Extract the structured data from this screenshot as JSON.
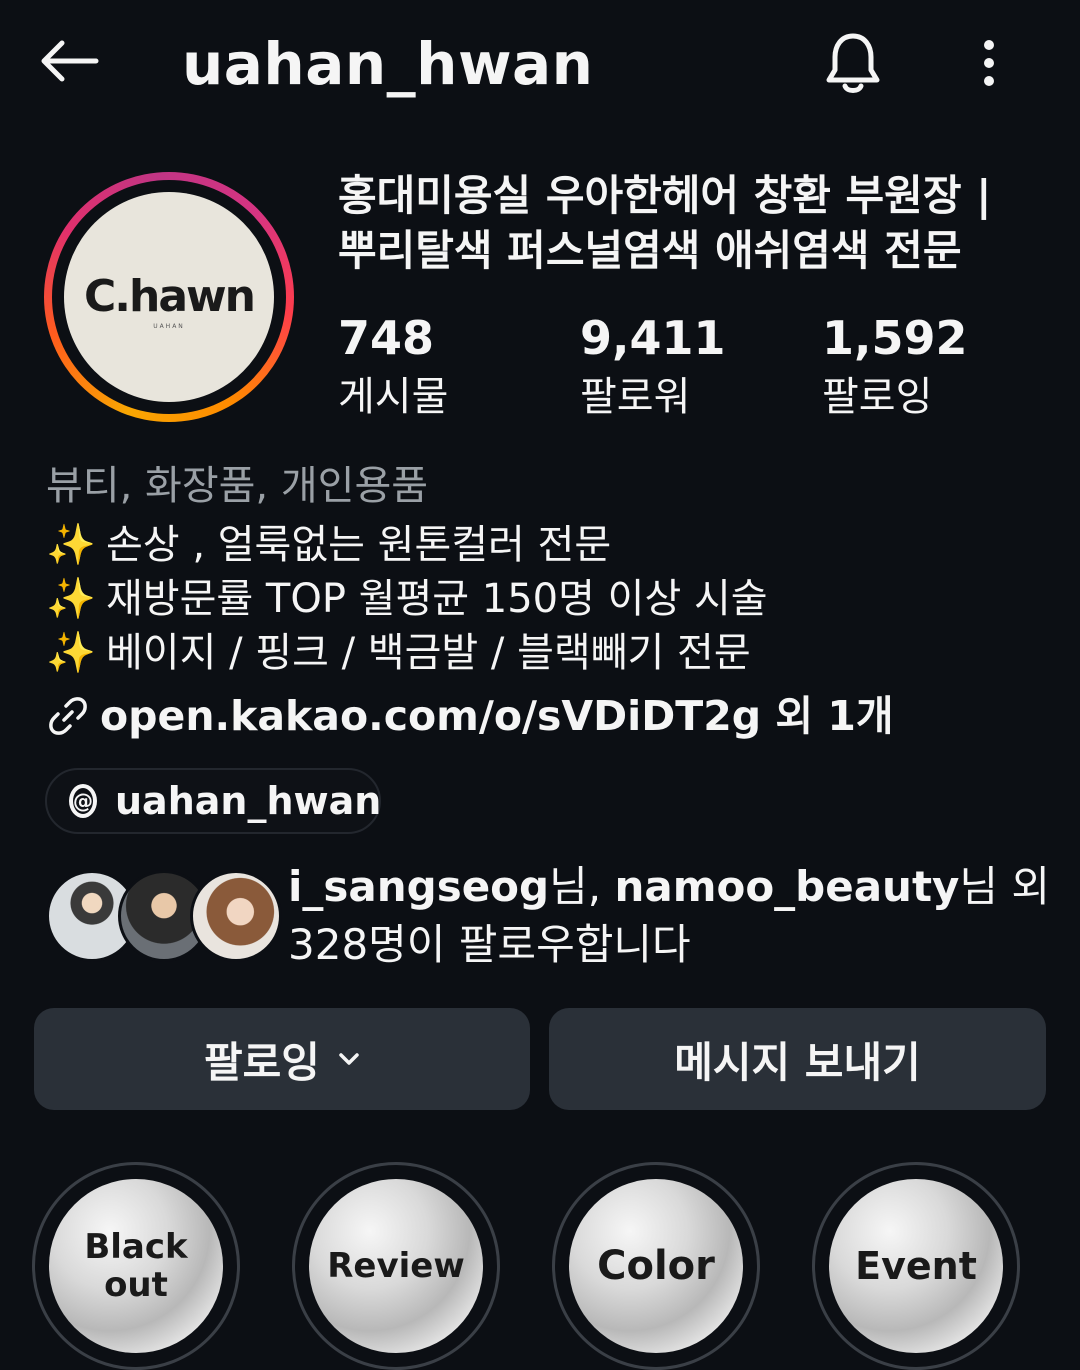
{
  "header": {
    "username": "uahan_hwan",
    "back_icon": "back-arrow-icon",
    "notification_icon": "bell-icon",
    "more_icon": "more-vertical-icon"
  },
  "profile": {
    "avatar_logo_text": "C.hawn",
    "avatar_logo_sub": "UAHAN",
    "name_line1": "홍대미용실 우아한헤어 창환 부원장 |",
    "name_line2": "뿌리탈색 퍼스널염색 애쉬염색 전문"
  },
  "stats": [
    {
      "value": "748",
      "label": "게시물"
    },
    {
      "value": "9,411",
      "label": "팔로워"
    },
    {
      "value": "1,592",
      "label": "팔로잉"
    }
  ],
  "bio": {
    "category": "뷰티, 화장품, 개인용품",
    "lines": [
      {
        "emoji": "✨",
        "text": "손상 , 얼룩없는 원톤컬러 전문"
      },
      {
        "emoji": "✨",
        "text": "재방문률 TOP 월평균 150명 이상 시술"
      },
      {
        "emoji": "✨",
        "text": "베이지 / 핑크 / 백금발 / 블랙빼기 전문"
      }
    ],
    "link_text": "open.kakao.com/o/sVDiDT2g 외 1개"
  },
  "threads": {
    "label": "uahan_hwan"
  },
  "mutual": {
    "user1": "i_sangseog",
    "suffix1": "님, ",
    "user2": "namoo_beauty",
    "suffix2": "님 외",
    "line2": "328명이 팔로우합니다"
  },
  "actions": {
    "following_label": "팔로잉",
    "message_label": "메시지 보내기"
  },
  "highlights": [
    {
      "line1": "Black",
      "line2": "out"
    },
    {
      "line1": "Review",
      "line2": ""
    },
    {
      "line1": "Color",
      "line2": ""
    },
    {
      "line1": "Event",
      "line2": ""
    }
  ],
  "colors": {
    "background": "#0c0f14",
    "button_bg": "#2a3038",
    "category_gray": "#9aa0a6"
  }
}
